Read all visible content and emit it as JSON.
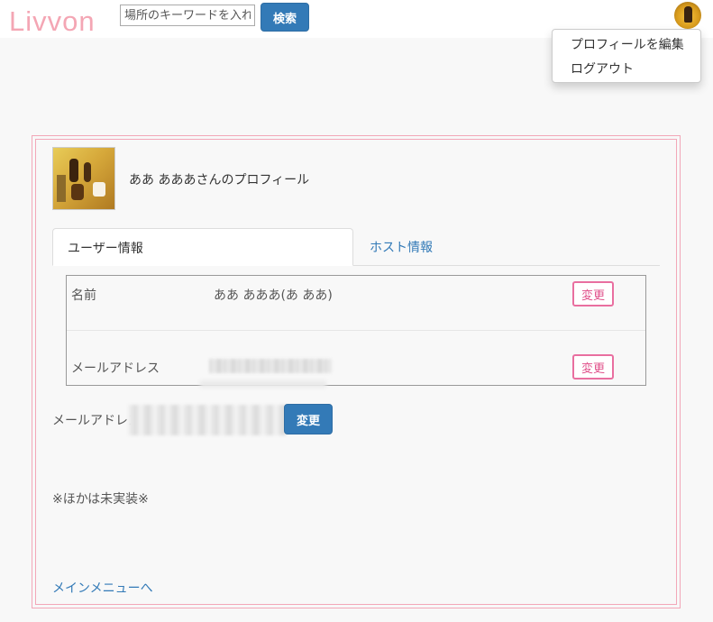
{
  "header": {
    "logo": "Livvon",
    "search_placeholder": "場所のキーワードを入れて",
    "search_button": "検索"
  },
  "user_menu": {
    "items": [
      {
        "label": "プロフィールを編集"
      },
      {
        "label": "ログアウト"
      }
    ]
  },
  "profile": {
    "title": "ああ あああさんのプロフィール"
  },
  "tabs": [
    {
      "label": "ユーザー情報",
      "active": true
    },
    {
      "label": "ホスト情報",
      "active": false
    }
  ],
  "info_table": {
    "rows": [
      {
        "label": "名前",
        "value": "ああ あああ(あ ああ)",
        "button": "変更"
      },
      {
        "label": "メールアドレス",
        "value": "",
        "button": "変更"
      }
    ]
  },
  "email_form": {
    "label": "メールアドレス",
    "button": "変更"
  },
  "note": "※ほかは未実装※",
  "footer_link": "メインメニューへ",
  "colors": {
    "brand": "#f4a6b4",
    "primary": "#337ab7",
    "accent_outline": "#e96fa0",
    "frame": "#f2a7b8"
  }
}
